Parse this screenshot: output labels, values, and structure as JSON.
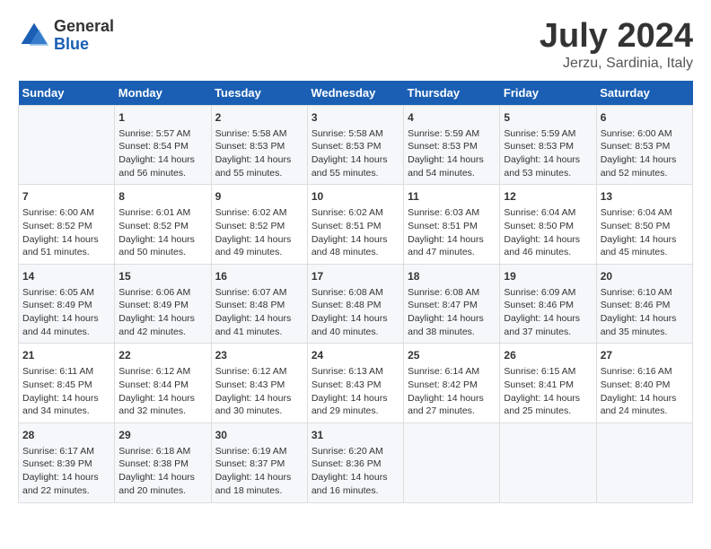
{
  "logo": {
    "general": "General",
    "blue": "Blue"
  },
  "title": {
    "month": "July 2024",
    "location": "Jerzu, Sardinia, Italy"
  },
  "days_of_week": [
    "Sunday",
    "Monday",
    "Tuesday",
    "Wednesday",
    "Thursday",
    "Friday",
    "Saturday"
  ],
  "weeks": [
    [
      {
        "day": "",
        "sunrise": "",
        "sunset": "",
        "daylight": ""
      },
      {
        "day": "1",
        "sunrise": "Sunrise: 5:57 AM",
        "sunset": "Sunset: 8:54 PM",
        "daylight": "Daylight: 14 hours and 56 minutes."
      },
      {
        "day": "2",
        "sunrise": "Sunrise: 5:58 AM",
        "sunset": "Sunset: 8:53 PM",
        "daylight": "Daylight: 14 hours and 55 minutes."
      },
      {
        "day": "3",
        "sunrise": "Sunrise: 5:58 AM",
        "sunset": "Sunset: 8:53 PM",
        "daylight": "Daylight: 14 hours and 55 minutes."
      },
      {
        "day": "4",
        "sunrise": "Sunrise: 5:59 AM",
        "sunset": "Sunset: 8:53 PM",
        "daylight": "Daylight: 14 hours and 54 minutes."
      },
      {
        "day": "5",
        "sunrise": "Sunrise: 5:59 AM",
        "sunset": "Sunset: 8:53 PM",
        "daylight": "Daylight: 14 hours and 53 minutes."
      },
      {
        "day": "6",
        "sunrise": "Sunrise: 6:00 AM",
        "sunset": "Sunset: 8:53 PM",
        "daylight": "Daylight: 14 hours and 52 minutes."
      }
    ],
    [
      {
        "day": "7",
        "sunrise": "Sunrise: 6:00 AM",
        "sunset": "Sunset: 8:52 PM",
        "daylight": "Daylight: 14 hours and 51 minutes."
      },
      {
        "day": "8",
        "sunrise": "Sunrise: 6:01 AM",
        "sunset": "Sunset: 8:52 PM",
        "daylight": "Daylight: 14 hours and 50 minutes."
      },
      {
        "day": "9",
        "sunrise": "Sunrise: 6:02 AM",
        "sunset": "Sunset: 8:52 PM",
        "daylight": "Daylight: 14 hours and 49 minutes."
      },
      {
        "day": "10",
        "sunrise": "Sunrise: 6:02 AM",
        "sunset": "Sunset: 8:51 PM",
        "daylight": "Daylight: 14 hours and 48 minutes."
      },
      {
        "day": "11",
        "sunrise": "Sunrise: 6:03 AM",
        "sunset": "Sunset: 8:51 PM",
        "daylight": "Daylight: 14 hours and 47 minutes."
      },
      {
        "day": "12",
        "sunrise": "Sunrise: 6:04 AM",
        "sunset": "Sunset: 8:50 PM",
        "daylight": "Daylight: 14 hours and 46 minutes."
      },
      {
        "day": "13",
        "sunrise": "Sunrise: 6:04 AM",
        "sunset": "Sunset: 8:50 PM",
        "daylight": "Daylight: 14 hours and 45 minutes."
      }
    ],
    [
      {
        "day": "14",
        "sunrise": "Sunrise: 6:05 AM",
        "sunset": "Sunset: 8:49 PM",
        "daylight": "Daylight: 14 hours and 44 minutes."
      },
      {
        "day": "15",
        "sunrise": "Sunrise: 6:06 AM",
        "sunset": "Sunset: 8:49 PM",
        "daylight": "Daylight: 14 hours and 42 minutes."
      },
      {
        "day": "16",
        "sunrise": "Sunrise: 6:07 AM",
        "sunset": "Sunset: 8:48 PM",
        "daylight": "Daylight: 14 hours and 41 minutes."
      },
      {
        "day": "17",
        "sunrise": "Sunrise: 6:08 AM",
        "sunset": "Sunset: 8:48 PM",
        "daylight": "Daylight: 14 hours and 40 minutes."
      },
      {
        "day": "18",
        "sunrise": "Sunrise: 6:08 AM",
        "sunset": "Sunset: 8:47 PM",
        "daylight": "Daylight: 14 hours and 38 minutes."
      },
      {
        "day": "19",
        "sunrise": "Sunrise: 6:09 AM",
        "sunset": "Sunset: 8:46 PM",
        "daylight": "Daylight: 14 hours and 37 minutes."
      },
      {
        "day": "20",
        "sunrise": "Sunrise: 6:10 AM",
        "sunset": "Sunset: 8:46 PM",
        "daylight": "Daylight: 14 hours and 35 minutes."
      }
    ],
    [
      {
        "day": "21",
        "sunrise": "Sunrise: 6:11 AM",
        "sunset": "Sunset: 8:45 PM",
        "daylight": "Daylight: 14 hours and 34 minutes."
      },
      {
        "day": "22",
        "sunrise": "Sunrise: 6:12 AM",
        "sunset": "Sunset: 8:44 PM",
        "daylight": "Daylight: 14 hours and 32 minutes."
      },
      {
        "day": "23",
        "sunrise": "Sunrise: 6:12 AM",
        "sunset": "Sunset: 8:43 PM",
        "daylight": "Daylight: 14 hours and 30 minutes."
      },
      {
        "day": "24",
        "sunrise": "Sunrise: 6:13 AM",
        "sunset": "Sunset: 8:43 PM",
        "daylight": "Daylight: 14 hours and 29 minutes."
      },
      {
        "day": "25",
        "sunrise": "Sunrise: 6:14 AM",
        "sunset": "Sunset: 8:42 PM",
        "daylight": "Daylight: 14 hours and 27 minutes."
      },
      {
        "day": "26",
        "sunrise": "Sunrise: 6:15 AM",
        "sunset": "Sunset: 8:41 PM",
        "daylight": "Daylight: 14 hours and 25 minutes."
      },
      {
        "day": "27",
        "sunrise": "Sunrise: 6:16 AM",
        "sunset": "Sunset: 8:40 PM",
        "daylight": "Daylight: 14 hours and 24 minutes."
      }
    ],
    [
      {
        "day": "28",
        "sunrise": "Sunrise: 6:17 AM",
        "sunset": "Sunset: 8:39 PM",
        "daylight": "Daylight: 14 hours and 22 minutes."
      },
      {
        "day": "29",
        "sunrise": "Sunrise: 6:18 AM",
        "sunset": "Sunset: 8:38 PM",
        "daylight": "Daylight: 14 hours and 20 minutes."
      },
      {
        "day": "30",
        "sunrise": "Sunrise: 6:19 AM",
        "sunset": "Sunset: 8:37 PM",
        "daylight": "Daylight: 14 hours and 18 minutes."
      },
      {
        "day": "31",
        "sunrise": "Sunrise: 6:20 AM",
        "sunset": "Sunset: 8:36 PM",
        "daylight": "Daylight: 14 hours and 16 minutes."
      },
      {
        "day": "",
        "sunrise": "",
        "sunset": "",
        "daylight": ""
      },
      {
        "day": "",
        "sunrise": "",
        "sunset": "",
        "daylight": ""
      },
      {
        "day": "",
        "sunrise": "",
        "sunset": "",
        "daylight": ""
      }
    ]
  ]
}
